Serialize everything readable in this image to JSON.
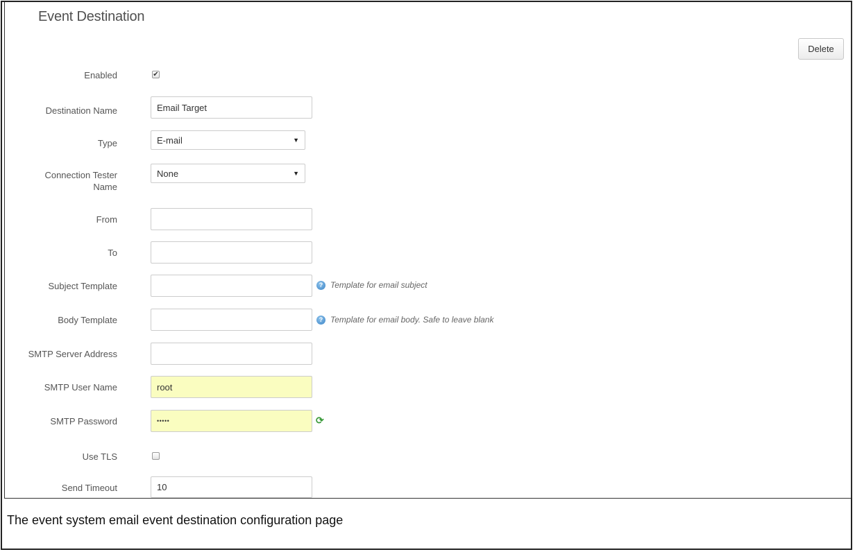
{
  "page_title": "Event Destination",
  "delete_label": "Delete",
  "fields": {
    "enabled": {
      "label": "Enabled",
      "checked": true,
      "check_glyph": "✔"
    },
    "destination_name": {
      "label": "Destination Name",
      "value": "Email Target"
    },
    "type": {
      "label": "Type",
      "value": "E-mail"
    },
    "connection_tester": {
      "label": "Connection Tester Name",
      "value": "None"
    },
    "from": {
      "label": "From",
      "value": ""
    },
    "to": {
      "label": "To",
      "value": ""
    },
    "subject_template": {
      "label": "Subject Template",
      "value": "",
      "hint": "Template for email subject"
    },
    "body_template": {
      "label": "Body Template",
      "value": "",
      "hint": "Template for email body. Safe to leave blank"
    },
    "smtp_server": {
      "label": "SMTP Server Address",
      "value": ""
    },
    "smtp_user": {
      "label": "SMTP User Name",
      "value": "root"
    },
    "smtp_password": {
      "label": "SMTP Password",
      "value": "•••••"
    },
    "use_tls": {
      "label": "Use TLS",
      "checked": false
    },
    "send_timeout": {
      "label": "Send Timeout",
      "value": "10"
    }
  },
  "icons": {
    "info": "info-icon",
    "refresh": "refresh-icon",
    "caret": "▼"
  },
  "colors": {
    "autofill_yellow": "#fafdc0",
    "info_blue": "#3a83c6",
    "refresh_green": "#3a9a3a"
  },
  "caption": "The event system email event destination configuration page"
}
